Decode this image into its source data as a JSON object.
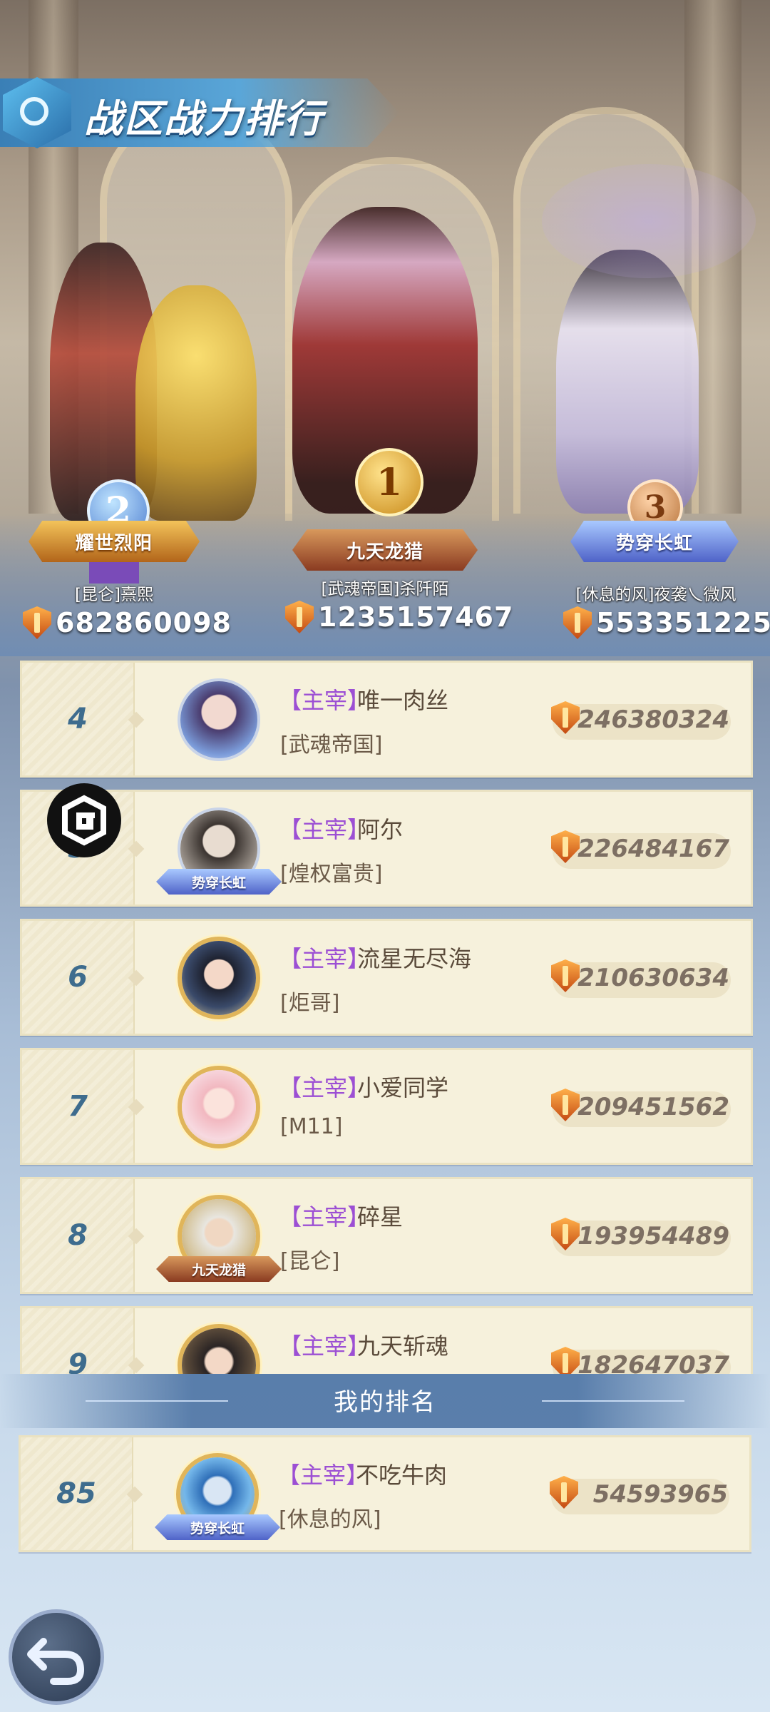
{
  "header": {
    "title": "战区战力排行"
  },
  "top3": [
    {
      "rank": "2",
      "title_badge": "耀世烈阳",
      "name": "[昆仑]熹熙",
      "power": "682860098"
    },
    {
      "rank": "1",
      "title_badge": "九天龙猎",
      "name": "[武魂帝国]杀阡陌",
      "power": "1235157467"
    },
    {
      "rank": "3",
      "title_badge": "势穿长虹",
      "name": "[休息的风]夜袭乀微风",
      "power": "553351225"
    }
  ],
  "rankings": [
    {
      "rank": "4",
      "tag": "【主宰】",
      "name": "唯一肉丝",
      "guild": "[武魂帝国]",
      "power": "246380324",
      "avatar_badge": ""
    },
    {
      "rank": "5",
      "tag": "【主宰】",
      "name": "阿尔",
      "guild": "[煌权富贵]",
      "power": "226484167",
      "avatar_badge": "势穿长虹"
    },
    {
      "rank": "6",
      "tag": "【主宰】",
      "name": "流星无尽海",
      "guild": "[炬哥]",
      "power": "210630634",
      "avatar_badge": ""
    },
    {
      "rank": "7",
      "tag": "【主宰】",
      "name": "小爱同学",
      "guild": "[M11]",
      "power": "209451562",
      "avatar_badge": ""
    },
    {
      "rank": "8",
      "tag": "【主宰】",
      "name": "碎星",
      "guild": "[昆仑]",
      "power": "193954489",
      "avatar_badge": "九天龙猎"
    },
    {
      "rank": "9",
      "tag": "【主宰】",
      "name": "九天斩魂",
      "guild": "",
      "power": "182647037",
      "avatar_badge": ""
    }
  ],
  "my_rank": {
    "label": "我的排名",
    "rank": "85",
    "tag": "【主宰】",
    "name": "不吃牛肉",
    "guild": "[休息的风]",
    "power": "54593965",
    "avatar_badge": "势穿长虹"
  },
  "icons": {
    "power": "shield-sword-icon",
    "back": "undo-arrow-icon",
    "overlay": "g-logo-icon"
  },
  "colors": {
    "tag_purple": "#9c4fd4",
    "rank_blue": "#3e6c8e",
    "row_bg": "#f6f1dc"
  }
}
